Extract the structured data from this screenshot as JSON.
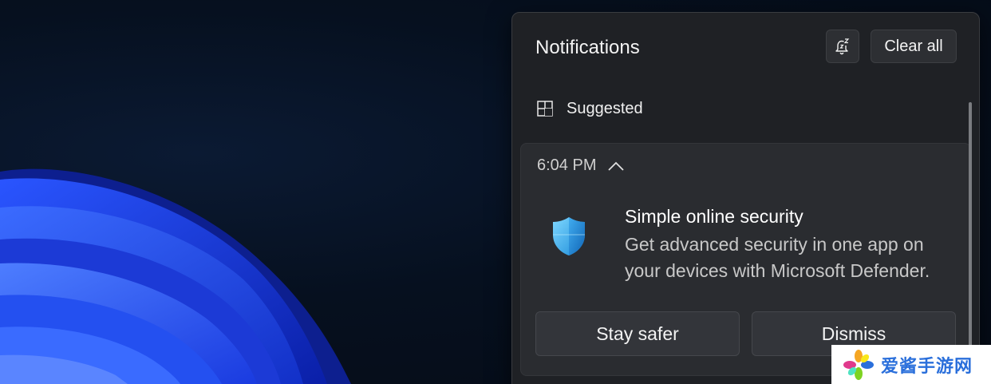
{
  "notification_center": {
    "title": "Notifications",
    "dnd_button_icon": "snooze-bell-icon",
    "clear_all_label": "Clear all",
    "group": {
      "icon": "tips-app-icon",
      "label": "Suggested"
    },
    "card": {
      "time": "6:04 PM",
      "collapse_icon": "chevron-up-icon",
      "app_icon": "defender-shield-icon",
      "title": "Simple online security",
      "body": "Get advanced security in one app on your devices with Microsoft Defender.",
      "actions": [
        {
          "label": "Stay safer"
        },
        {
          "label": "Dismiss"
        }
      ]
    }
  },
  "watermark": {
    "text": "爱酱手游网"
  },
  "colors": {
    "panel_bg": "#1f2125",
    "card_bg": "#2a2c30",
    "button_bg": "#33353a",
    "wallpaper_blue": "#1d3fe0",
    "accent_shield": "#37b4f0"
  }
}
